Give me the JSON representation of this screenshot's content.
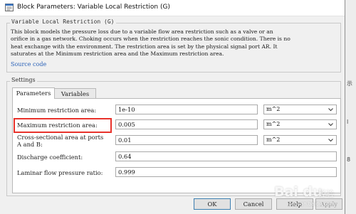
{
  "window": {
    "title": "Block Parameters: Variable Local Restriction (G)",
    "icon": "block-parameters-icon"
  },
  "description_group": {
    "label": "Variable Local Restriction (G)",
    "lines": [
      "This block models the pressure loss due to a variable flow area restriction such as a valve or an",
      "orifice in a gas network. Choking occurs when the restriction reaches the sonic condition. There is no",
      "heat exchange with the environment. The restriction area is set by the physical signal port AR. It",
      "saturates at the Minimum restriction area and the Maximum restriction area."
    ],
    "source_link": "Source code"
  },
  "settings": {
    "label": "Settings",
    "tabs": [
      {
        "label": "Parameters",
        "active": true
      },
      {
        "label": "Variables",
        "active": false
      }
    ],
    "rows": [
      {
        "label": "Minimum restriction area:",
        "value": "1e-10",
        "unit": "m^2",
        "has_unit": true
      },
      {
        "label": "Maximum restriction area:",
        "value": "0.005",
        "unit": "m^2",
        "has_unit": true,
        "highlighted": true
      },
      {
        "label_lines": [
          "Cross-sectional area at ports",
          "A and B:"
        ],
        "value": "0.01",
        "unit": "m^2",
        "has_unit": true
      },
      {
        "label": "Discharge coefficient:",
        "value": "0.64",
        "has_unit": false
      },
      {
        "label": "Laminar flow pressure ratio:",
        "value": "0.999",
        "has_unit": false
      }
    ]
  },
  "buttons": {
    "ok": "OK",
    "cancel": "Cancel",
    "help": "Help",
    "apply": "Apply"
  },
  "background_fragments": [
    "示",
    "l",
    "8"
  ],
  "watermark": {
    "logo": "Bai du",
    "sub": "经验",
    "url": "jingyan.baidu.com"
  },
  "colors": {
    "highlight": "#e8322b",
    "link": "#2a62b8",
    "default_button_border": "#3c7fb1"
  }
}
